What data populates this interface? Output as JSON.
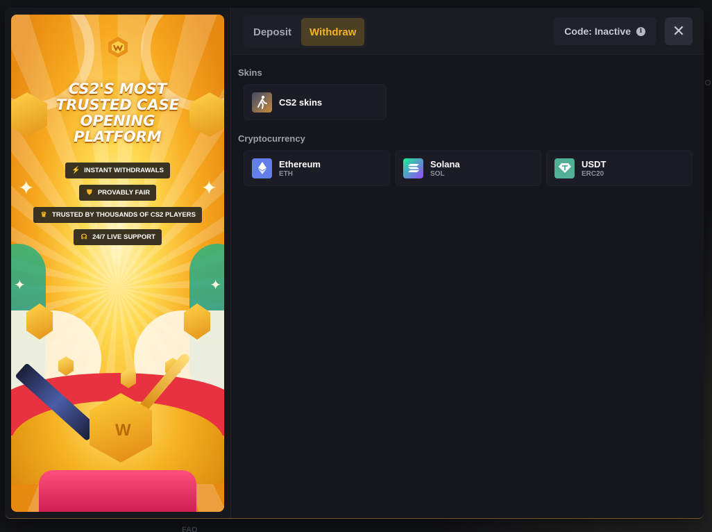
{
  "promo": {
    "title": "CS2'S MOST TRUSTED CASE OPENING PLATFORM",
    "badges": [
      {
        "icon": "lightning-icon",
        "label": "INSTANT WITHDRAWALS"
      },
      {
        "icon": "shield-icon",
        "label": "PROVABLY FAIR"
      },
      {
        "icon": "trophy-icon",
        "label": "TRUSTED BY THOUSANDS OF CS2 PLAYERS"
      },
      {
        "icon": "headset-icon",
        "label": "24/7 LIVE SUPPORT"
      }
    ],
    "coin_letter": "W"
  },
  "tabs": [
    {
      "label": "Deposit",
      "active": false
    },
    {
      "label": "Withdraw",
      "active": true
    }
  ],
  "code": {
    "label": "Code: Inactive",
    "icon": "info-icon"
  },
  "close": {
    "icon": "close-icon",
    "glyph": "✕"
  },
  "sections": {
    "skins": {
      "label": "Skins",
      "options": [
        {
          "name": "CS2 skins",
          "icon": "player-icon"
        }
      ]
    },
    "crypto": {
      "label": "Cryptocurrency",
      "options": [
        {
          "name": "Ethereum",
          "ticker": "ETH",
          "icon": "ethereum-icon",
          "color": "#627eea"
        },
        {
          "name": "Solana",
          "ticker": "SOL",
          "icon": "solana-icon",
          "color": "#9b5de5"
        },
        {
          "name": "USDT",
          "ticker": "ERC20",
          "icon": "tether-icon",
          "color": "#50af95"
        }
      ]
    }
  },
  "background": {
    "footer_link": "FAQ"
  },
  "colors": {
    "accent": "#f5b325",
    "active_tab_bg": "#4c4024",
    "panel_bg": "#16171d"
  }
}
